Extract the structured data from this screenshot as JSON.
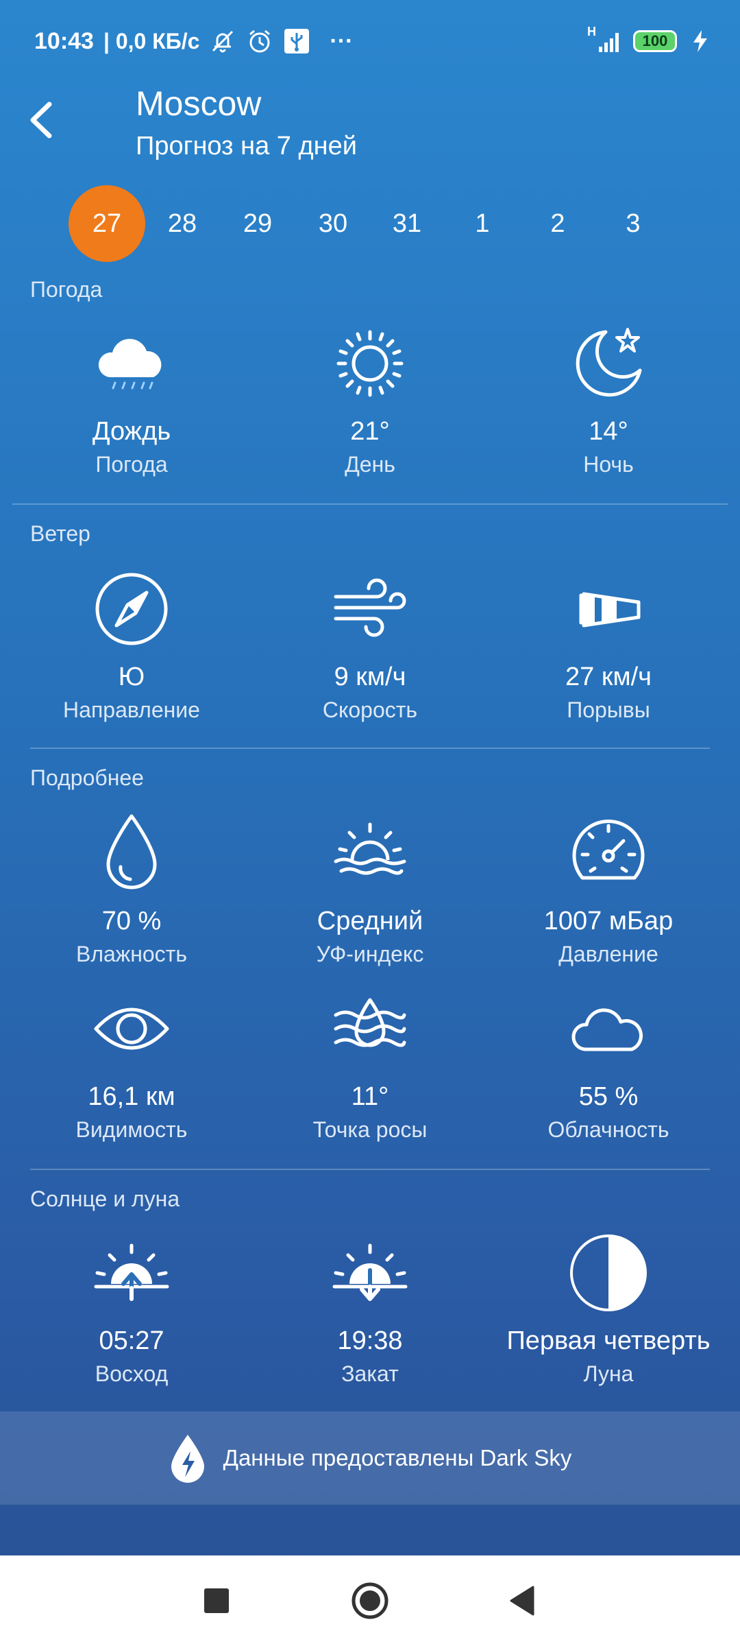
{
  "status_bar": {
    "time": "10:43",
    "net_speed": "| 0,0 КБ/с",
    "more": "···",
    "network_type": "H",
    "battery": "100"
  },
  "header": {
    "city": "Moscow",
    "subtitle": "Прогноз на 7 дней"
  },
  "dates": [
    {
      "label": "27",
      "selected": true
    },
    {
      "label": "28"
    },
    {
      "label": "29"
    },
    {
      "label": "30"
    },
    {
      "label": "31"
    },
    {
      "label": "1"
    },
    {
      "label": "2"
    },
    {
      "label": "3"
    }
  ],
  "sections": {
    "weather": {
      "title": "Погода",
      "items": [
        {
          "value": "Дождь",
          "label": "Погода",
          "icon": "rain-cloud-icon"
        },
        {
          "value": "21°",
          "label": "День",
          "icon": "sun-icon"
        },
        {
          "value": "14°",
          "label": "Ночь",
          "icon": "moon-star-icon"
        }
      ]
    },
    "wind": {
      "title": "Ветер",
      "items": [
        {
          "value": "Ю",
          "label": "Направление",
          "icon": "compass-icon"
        },
        {
          "value": "9 км/ч",
          "label": "Скорость",
          "icon": "wind-icon"
        },
        {
          "value": "27 км/ч",
          "label": "Порывы",
          "icon": "windsock-icon"
        }
      ]
    },
    "details": {
      "title": "Подробнее",
      "items": [
        {
          "value": "70 %",
          "label": "Влажность",
          "icon": "droplet-icon"
        },
        {
          "value": "Средний",
          "label": "УФ-индекс",
          "icon": "uv-sun-icon"
        },
        {
          "value": "1007 мБар",
          "label": "Давление",
          "icon": "gauge-icon"
        },
        {
          "value": "16,1 км",
          "label": "Видимость",
          "icon": "eye-icon"
        },
        {
          "value": "11°",
          "label": "Точка росы",
          "icon": "dew-point-icon"
        },
        {
          "value": "55 %",
          "label": "Облачность",
          "icon": "cloud-icon"
        }
      ]
    },
    "sun_moon": {
      "title": "Солнце и луна",
      "items": [
        {
          "value": "05:27",
          "label": "Восход",
          "icon": "sunrise-icon"
        },
        {
          "value": "19:38",
          "label": "Закат",
          "icon": "sunset-icon"
        },
        {
          "value": "Первая четверть",
          "label": "Луна",
          "icon": "moon-phase-icon"
        }
      ]
    }
  },
  "footer": {
    "text": "Данные предоставлены Dark Sky",
    "icon": "dark-sky-icon"
  },
  "colors": {
    "accent": "#f07b1a",
    "background_top": "#2b86ce",
    "background_bottom": "#2a5193"
  }
}
